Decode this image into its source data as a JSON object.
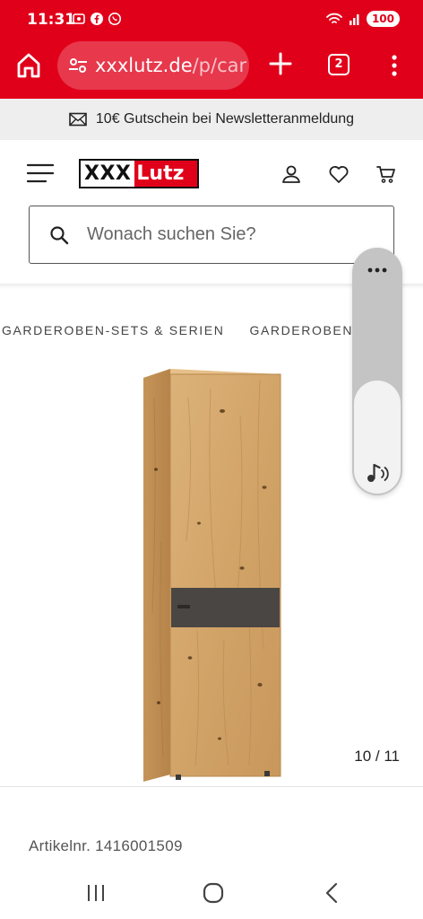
{
  "status_bar": {
    "time": "11:31",
    "battery": "100"
  },
  "browser": {
    "url_domain": "xxxlutz.de",
    "url_path": "/p/car",
    "tab_count": "2",
    "accent_color": "#e1001a"
  },
  "banner": {
    "text": "10€ Gutschein bei Newsletteranmeldung",
    "icon": "mail-icon"
  },
  "header": {
    "logo_left": "XXX",
    "logo_right": "Lutz",
    "icons": [
      "menu-icon",
      "user-icon",
      "heart-icon",
      "cart-icon"
    ]
  },
  "search": {
    "placeholder": "Wonach suchen Sie?"
  },
  "breadcrumb": {
    "items": [
      "GARDEROBEN-SETS & SERIEN",
      "GARDEROBEN"
    ]
  },
  "gallery": {
    "counter": "10 / 11"
  },
  "product": {
    "article_number": "Artikelnr. 1416001509"
  }
}
